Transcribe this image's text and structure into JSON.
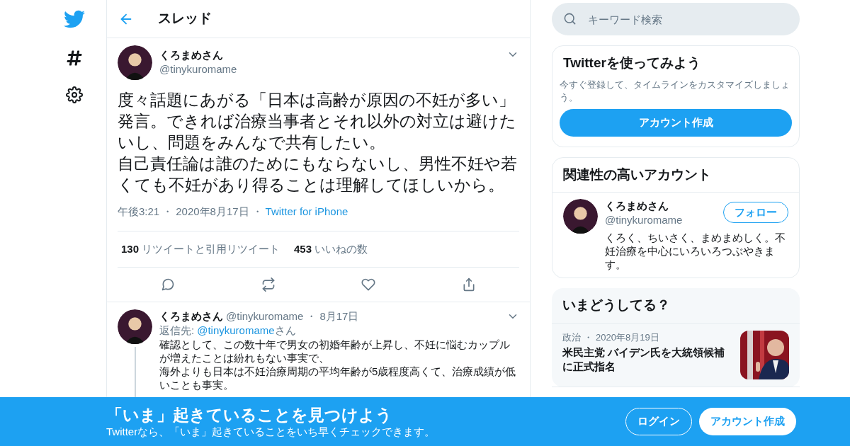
{
  "header": {
    "title": "スレッド"
  },
  "tweet": {
    "name": "くろまめさん",
    "handle": "@tinykuromame",
    "paragraphs": [
      "度々話題にあがる「日本は高齢が原因の不妊が多い」発言。できれば治療当事者とそれ以外の対立は避けたいし、問題をみんなで共有したい。",
      "自己責任論は誰のためにもならないし、男性不妊や若くても不妊があり得ることは理解してほしいから。"
    ],
    "time": "午後3:21",
    "date": "2020年8月17日",
    "source": "Twitter for iPhone",
    "retweets": "130",
    "retweets_label": "リツイートと引用リツイート",
    "likes": "453",
    "likes_label": "いいねの数"
  },
  "reply": {
    "name": "くろまめさん",
    "handle": "@tinykuromame",
    "date": "8月17日",
    "reply_to_label": "返信先:",
    "reply_to_handle": "@tinykuromame",
    "reply_to_suffix": "さん",
    "paragraphs": [
      "確認として、この数十年で男女の初婚年齢が上昇し、不妊に悩むカップルが増えたことは紛れもない事実で、",
      "海外よりも日本は不妊治療周期の平均年齢が5歳程度高くて、治療成績が低いことも事実。"
    ]
  },
  "separator": "・",
  "search": {
    "placeholder": "キーワード検索"
  },
  "signup_card": {
    "title": "Twitterを使ってみよう",
    "text": "今すぐ登録して、タイムラインをカスタマイズしましょう。",
    "button": "アカウント作成"
  },
  "related": {
    "title": "関連性の高いアカウント",
    "name": "くろまめさん",
    "handle": "@tinykuromame",
    "follow": "フォロー",
    "bio": "くろく、ちいさく、まめまめしく。不妊治療を中心にいろいろつぶやきます。"
  },
  "trends": {
    "title": "いまどうしてる？",
    "items": [
      {
        "category": "政治",
        "date": "2020年8月19日",
        "headline": "米民主党 バイデン氏を大統領候補に正式指名"
      }
    ]
  },
  "banner": {
    "title": "「いま」起きていることを見つけよう",
    "subtitle": "Twitterなら、「いま」起きていることをいち早くチェックできます。",
    "login": "ログイン",
    "signup": "アカウント作成"
  }
}
